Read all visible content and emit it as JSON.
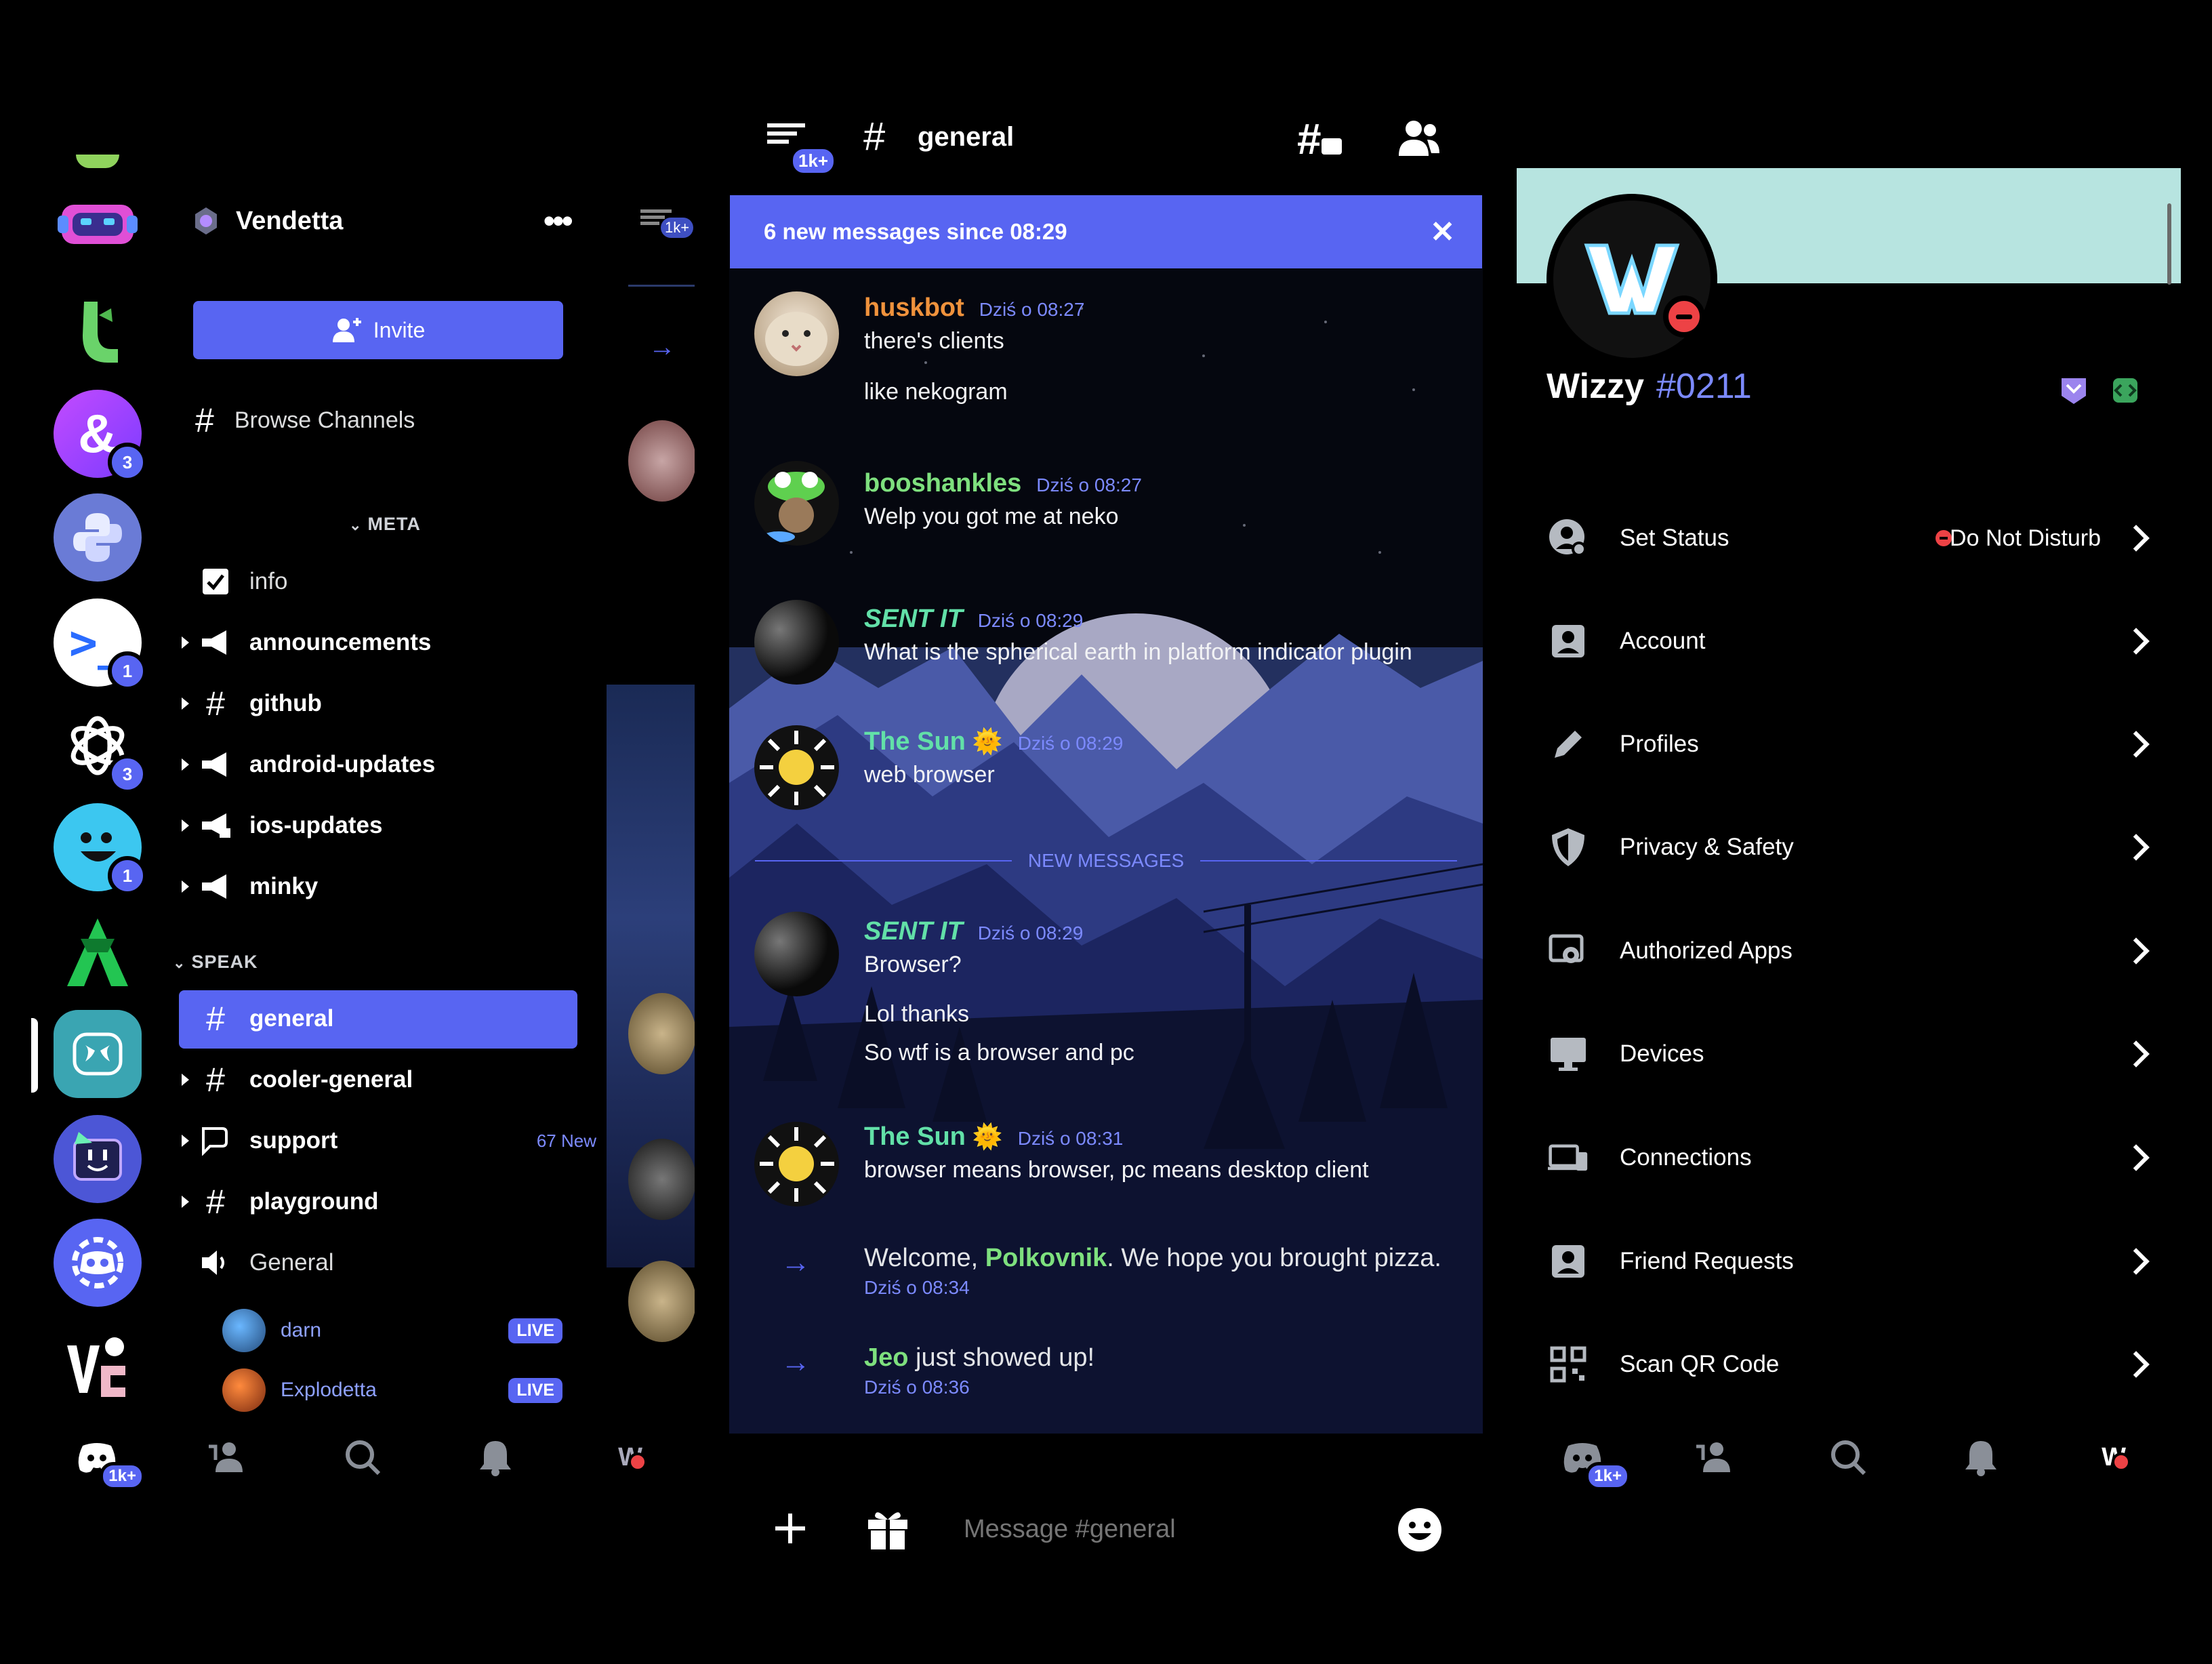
{
  "server_rail": {
    "badges": [
      "3",
      "1",
      "3",
      "1"
    ],
    "colors": {
      "accent": "#5865f2"
    }
  },
  "guild": {
    "name": "Vendetta",
    "invite_label": "Invite",
    "browse_label": "Browse Channels",
    "categories": {
      "meta": "META",
      "speak": "SPEAK"
    },
    "meta_channels": [
      "info",
      "announcements",
      "github",
      "android-updates",
      "ios-updates",
      "minky"
    ],
    "speak_channels": [
      "general",
      "cooler-general",
      "support",
      "playground",
      "General"
    ],
    "support_badge": "67 New",
    "voice_users": [
      {
        "name": "darn",
        "status": "LIVE"
      },
      {
        "name": "Explodetta",
        "status": "LIVE"
      }
    ]
  },
  "tabs": {
    "home_badge": "1k+"
  },
  "peek": {
    "badge": "1k+"
  },
  "chat": {
    "header_badge": "1k+",
    "channel_name": "general",
    "banner": "6 new messages since 08:29",
    "new_messages_divider": "NEW MESSAGES",
    "messages": [
      {
        "author": "huskbot",
        "time": "Dziś o 08:27",
        "lines": [
          "there's clients",
          "like nekogram"
        ],
        "color": "#f0923c"
      },
      {
        "author": "booshankles",
        "time": "Dziś o 08:27",
        "lines": [
          "Welp you got me at neko"
        ],
        "color": "#7ee07e"
      },
      {
        "author": "SENT IT",
        "time": "Dziś o 08:29",
        "lines": [
          "What is the spherical earth in platform indicator plugin"
        ],
        "color": "#62e0a8"
      },
      {
        "author": "The Sun",
        "emoji": "🌞",
        "time": "Dziś o 08:29",
        "lines": [
          "web browser"
        ],
        "color": "#62e0a8"
      },
      {
        "author": "SENT IT",
        "time": "Dziś o 08:29",
        "lines": [
          "Browser?",
          "Lol thanks",
          "So wtf is a browser and pc"
        ],
        "color": "#62e0a8"
      },
      {
        "author": "The Sun",
        "emoji": "🌞",
        "time": "Dziś o 08:31",
        "lines": [
          "browser means browser, pc means desktop client"
        ],
        "color": "#62e0a8"
      }
    ],
    "system": [
      {
        "pre": "Welcome, ",
        "name": "Polkovnik",
        "post": ". We hope you brought pizza.",
        "time": "Dziś o 08:34"
      },
      {
        "pre": "",
        "name": "Jeo",
        "post": " just showed up!",
        "time": "Dziś o 08:36"
      }
    ],
    "input_placeholder": "Message #general"
  },
  "profile": {
    "username": "Wizzy",
    "discriminator": "#0211",
    "banner_color": "#b7e4e0",
    "status_dnd_color": "#ed4245",
    "settings": [
      {
        "label": "Set Status",
        "value": "Do Not Disturb",
        "icon": "status-icon"
      },
      {
        "label": "Account",
        "icon": "account-icon"
      },
      {
        "label": "Profiles",
        "icon": "pencil-icon"
      },
      {
        "label": "Privacy & Safety",
        "icon": "shield-icon"
      },
      {
        "label": "Authorized Apps",
        "icon": "apps-icon"
      },
      {
        "label": "Devices",
        "icon": "monitor-icon"
      },
      {
        "label": "Connections",
        "icon": "devices-icon"
      },
      {
        "label": "Friend Requests",
        "icon": "friend-icon"
      },
      {
        "label": "Scan QR Code",
        "icon": "qr-icon"
      }
    ]
  }
}
